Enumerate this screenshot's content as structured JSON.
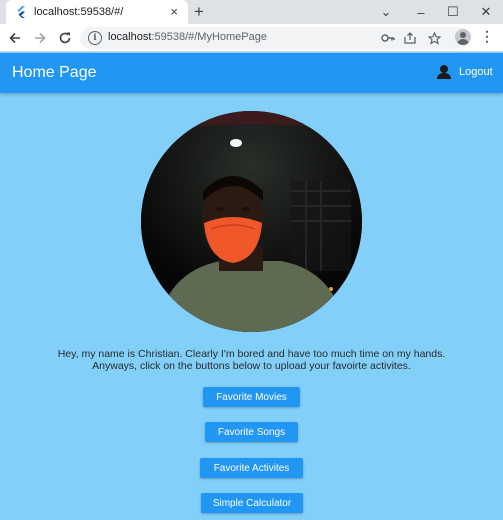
{
  "browser": {
    "tab_title": "localhost:59538/#/",
    "tab_close": "×",
    "new_tab": "+",
    "url_host": "localhost",
    "url_path": ":59538/#/MyHomePage",
    "window_controls": {
      "dropdown": "⌄",
      "minimize": "–",
      "maximize": "☐",
      "close": "✕"
    }
  },
  "appbar": {
    "title": "Home Page",
    "logout_label": "Logout",
    "logout_icon": "person-icon"
  },
  "intro": {
    "line1": "Hey, my name is Christian. Clearly I'm bored and have too much time on my hands.",
    "line2": "Anyways, click on the buttons below to upload your favoirte activites."
  },
  "buttons": [
    {
      "label": "Favorite Movies"
    },
    {
      "label": "Favorite Songs"
    },
    {
      "label": "Favorite Activites"
    },
    {
      "label": "Simple Calculator"
    }
  ],
  "colors": {
    "background": "#82cffa",
    "appbar": "#2196f3",
    "button": "#2196f3",
    "mask": "#f0582a"
  }
}
